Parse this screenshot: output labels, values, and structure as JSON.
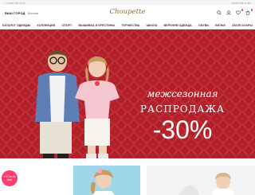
{
  "topbar": {
    "phone_left": "+7 (495) 150-43-31",
    "phone_right": "8 (800) 555-97-88"
  },
  "header": {
    "city_label": "ВАШ ГОРОД",
    "city_value": "Москва",
    "logo": "Choupette",
    "cart_count": "0",
    "wishlist_count": "0"
  },
  "nav": {
    "items": [
      "КАТАЛОГ ОДЕЖДЫ",
      "КОЛЛЕКЦИИ",
      "СПОРТ",
      "ВЫШИВКА И КРЕСТИНЫ",
      "ТОРЖЕСТВА",
      "ШКОЛА",
      "ВЕРХНЯЯ ОДЕЖДА",
      "ОБУВЬ",
      "БЕЛЬЕ",
      "АКСЕССУАРЫ"
    ]
  },
  "banner": {
    "line1": "межсезонная",
    "line2": "РАСПРОДАЖА",
    "line3": "-30%",
    "color_bg": "#b5212b"
  },
  "tiles": {
    "sticker": "с 07 по 11 мая!"
  }
}
